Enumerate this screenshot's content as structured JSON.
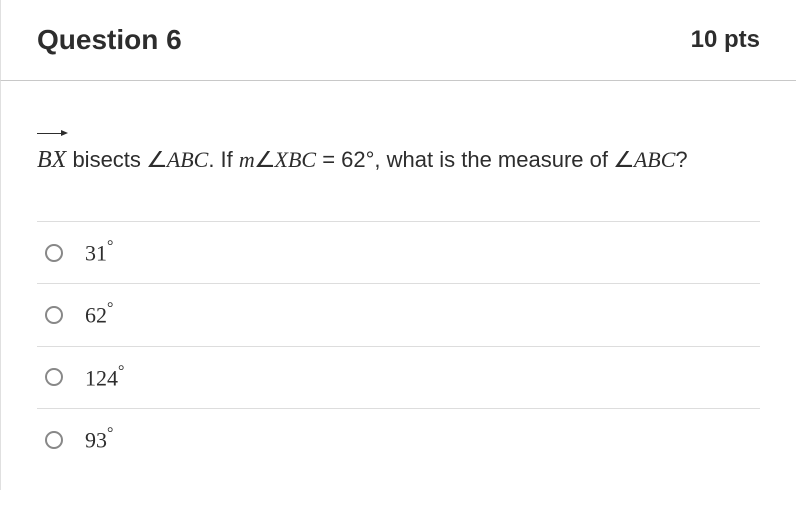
{
  "header": {
    "title": "Question 6",
    "points": "10 pts"
  },
  "prompt": {
    "ray": "BX",
    "text1": " bisects ",
    "angle1_label": "ABC",
    "text2": ". If ",
    "m": "m",
    "angle2_label": "XBC",
    "text3": " = 62°, what is the measure of ",
    "angle3_label": "ABC",
    "text4": "?"
  },
  "options": [
    {
      "value": "31",
      "deg": "°"
    },
    {
      "value": "62",
      "deg": "°"
    },
    {
      "value": "124",
      "deg": "°"
    },
    {
      "value": "93",
      "deg": "°"
    }
  ]
}
